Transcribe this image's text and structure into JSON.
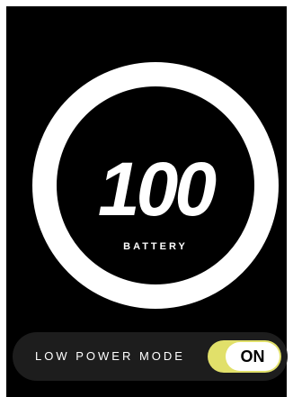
{
  "battery": {
    "level": "100",
    "label": "BATTERY"
  },
  "low_power_mode": {
    "label": "LOW POWER MODE",
    "state": "ON"
  },
  "colors": {
    "background": "#000000",
    "ring": "#ffffff",
    "toggle_track": "#e1e06a",
    "toggle_knob": "#ffffff",
    "bar": "#1d1d1d"
  }
}
